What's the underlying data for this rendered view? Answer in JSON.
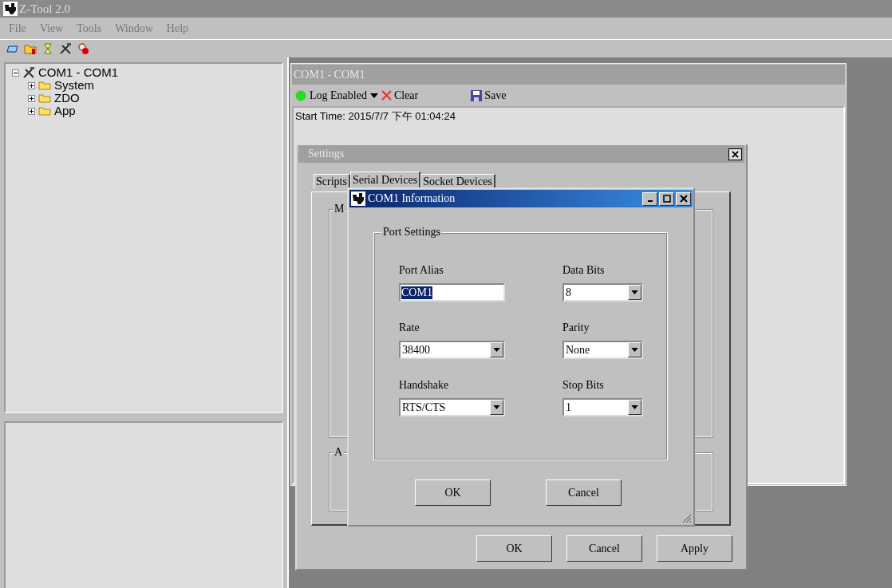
{
  "window": {
    "title": "Z-Tool 2.0"
  },
  "menu": [
    "File",
    "View",
    "Tools",
    "Window",
    "Help"
  ],
  "tree": {
    "label": "COM1 - COM1",
    "expanded": true,
    "children": [
      {
        "label": "System",
        "expanded": false
      },
      {
        "label": "ZDO",
        "expanded": false
      },
      {
        "label": "App",
        "expanded": false
      }
    ]
  },
  "log_window": {
    "title": "COM1 - COM1",
    "log": {
      "label": "Log Enabled",
      "on": true
    },
    "clear": "Clear",
    "save": "Save",
    "start_time": "Start Time: 2015/7/7 下午 01:04:24"
  },
  "settings_dialog": {
    "title": "Settings",
    "tabs": [
      {
        "label": "Scripts",
        "selected": false
      },
      {
        "label": "Serial Devices",
        "selected": true
      },
      {
        "label": "Socket Devices",
        "selected": false
      }
    ],
    "groups": [
      "M",
      "A"
    ],
    "buttons": [
      "OK",
      "Cancel",
      "Apply"
    ]
  },
  "info_dialog": {
    "title": "COM1 Information",
    "group": "Port Settings",
    "fields": [
      {
        "kind": "text",
        "label": "Port Alias",
        "value": "COM1",
        "selected": true
      },
      {
        "kind": "dropdown",
        "label": "Data Bits",
        "value": "8"
      },
      {
        "kind": "dropdown",
        "label": "Rate",
        "value": "38400"
      },
      {
        "kind": "dropdown",
        "label": "Parity",
        "value": "None"
      },
      {
        "kind": "dropdown",
        "label": "Handshake",
        "value": "RTS/CTS"
      },
      {
        "kind": "dropdown",
        "label": "Stop Bits",
        "value": "1"
      }
    ],
    "buttons": [
      "OK",
      "Cancel"
    ]
  }
}
